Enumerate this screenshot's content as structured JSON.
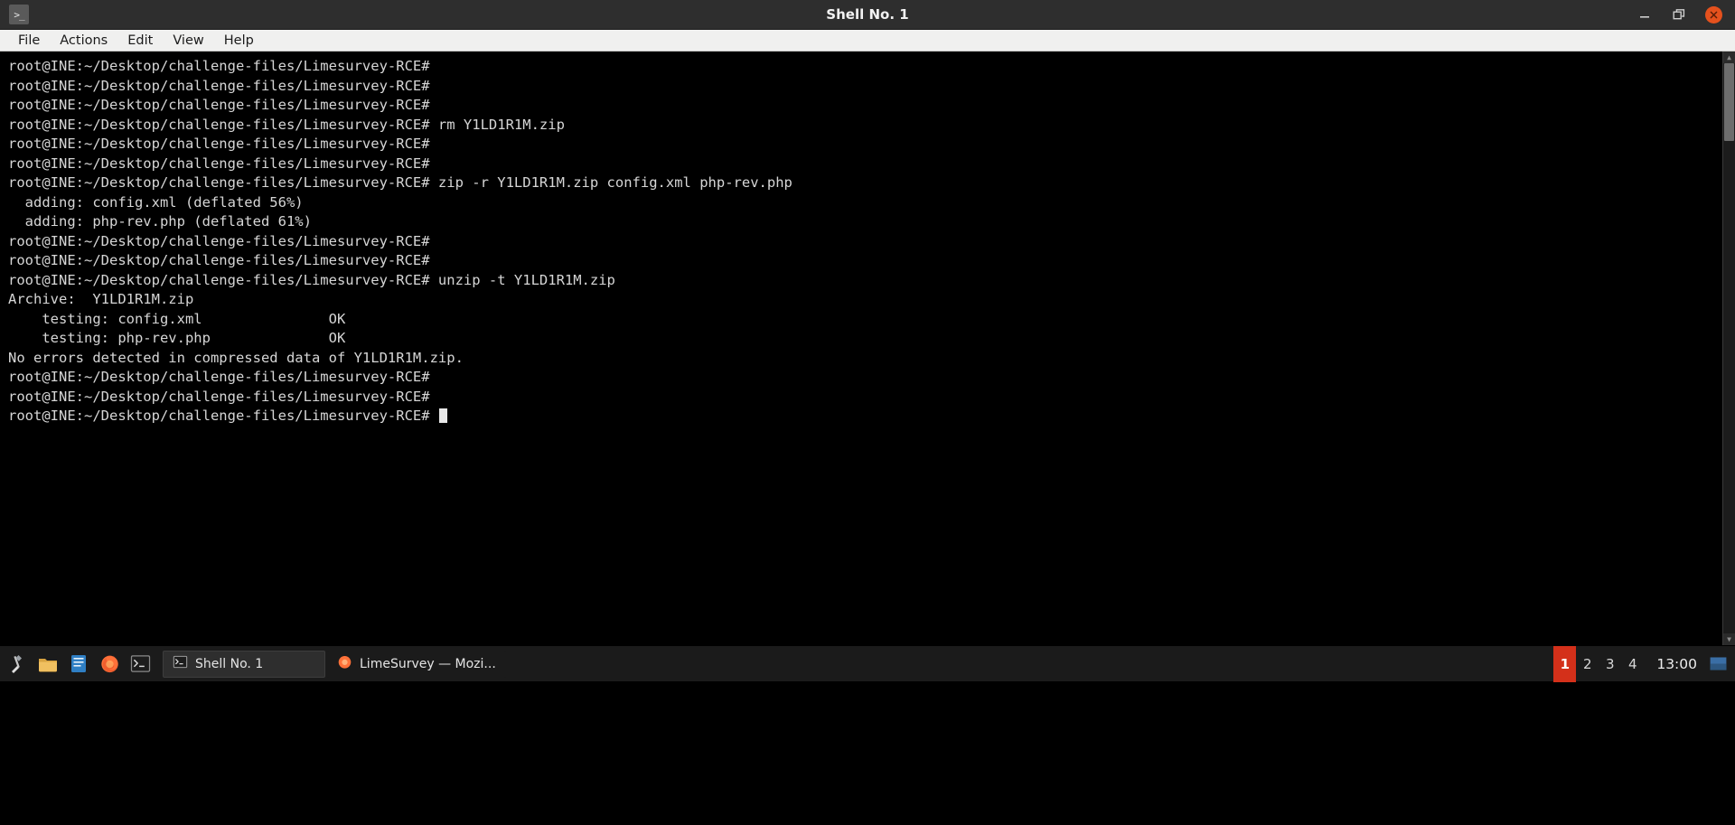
{
  "window": {
    "title": "Shell No. 1",
    "icon": "terminal-icon",
    "controls": {
      "minimize_label": "—",
      "maximize_label": "❐",
      "close_label": "✕"
    }
  },
  "menubar": {
    "items": [
      {
        "label": "File"
      },
      {
        "label": "Actions"
      },
      {
        "label": "Edit"
      },
      {
        "label": "View"
      },
      {
        "label": "Help"
      }
    ]
  },
  "terminal": {
    "prompt": "root@INE:~/Desktop/challenge-files/Limesurvey-RCE#",
    "background": "#000000",
    "foreground": "#d6d6d6",
    "lines": [
      "root@INE:~/Desktop/challenge-files/Limesurvey-RCE#",
      "root@INE:~/Desktop/challenge-files/Limesurvey-RCE#",
      "root@INE:~/Desktop/challenge-files/Limesurvey-RCE#",
      "root@INE:~/Desktop/challenge-files/Limesurvey-RCE# rm Y1LD1R1M.zip",
      "root@INE:~/Desktop/challenge-files/Limesurvey-RCE#",
      "root@INE:~/Desktop/challenge-files/Limesurvey-RCE#",
      "root@INE:~/Desktop/challenge-files/Limesurvey-RCE# zip -r Y1LD1R1M.zip config.xml php-rev.php",
      "  adding: config.xml (deflated 56%)",
      "  adding: php-rev.php (deflated 61%)",
      "root@INE:~/Desktop/challenge-files/Limesurvey-RCE#",
      "root@INE:~/Desktop/challenge-files/Limesurvey-RCE#",
      "root@INE:~/Desktop/challenge-files/Limesurvey-RCE# unzip -t Y1LD1R1M.zip",
      "Archive:  Y1LD1R1M.zip",
      "    testing: config.xml               OK",
      "    testing: php-rev.php              OK",
      "No errors detected in compressed data of Y1LD1R1M.zip.",
      "root@INE:~/Desktop/challenge-files/Limesurvey-RCE#",
      "root@INE:~/Desktop/challenge-files/Limesurvey-RCE#"
    ],
    "current_line": "root@INE:~/Desktop/challenge-files/Limesurvey-RCE# "
  },
  "taskbar": {
    "launchers": [
      {
        "name": "show-desktop-icon"
      },
      {
        "name": "file-manager-icon"
      },
      {
        "name": "text-editor-icon"
      },
      {
        "name": "firefox-icon"
      },
      {
        "name": "terminal-icon"
      }
    ],
    "tasks": [
      {
        "label": "Shell No. 1",
        "icon": "terminal-icon",
        "active": true
      },
      {
        "label": "LimeSurvey — Mozi...",
        "icon": "firefox-icon",
        "active": false
      }
    ],
    "workspaces": [
      {
        "label": "1",
        "active": true
      },
      {
        "label": "2",
        "active": false
      },
      {
        "label": "3",
        "active": false
      },
      {
        "label": "4",
        "active": false
      }
    ],
    "clock": "13:00",
    "active_workspace_color": "#d4301a",
    "tray": [
      {
        "name": "keyboard-layout-icon"
      }
    ]
  }
}
